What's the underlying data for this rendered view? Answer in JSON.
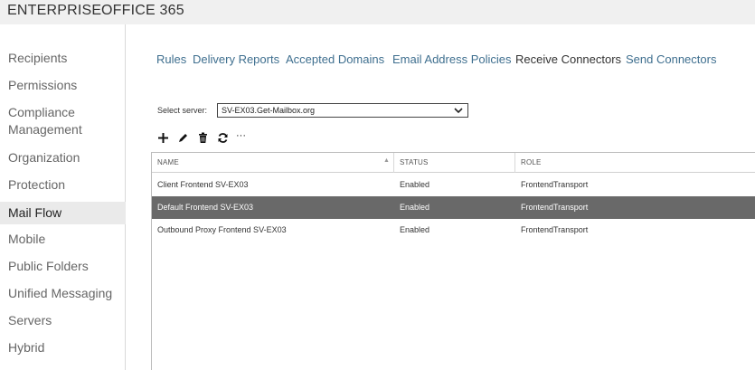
{
  "header": {
    "enterprise": "ENTERPRISE",
    "office365": "OFFICE 365"
  },
  "sidebar": {
    "items": [
      {
        "label": "Recipients"
      },
      {
        "label": "Permissions"
      },
      {
        "label": "Compliance"
      },
      {
        "label": "Management"
      },
      {
        "label": "Organization"
      },
      {
        "label": "Protection"
      },
      {
        "label": "Mail Flow"
      },
      {
        "label": "Mobile"
      },
      {
        "label": "Public Folders"
      },
      {
        "label": "Unified Messaging"
      },
      {
        "label": "Servers"
      },
      {
        "label": "Hybrid"
      }
    ],
    "active": "Mail Flow"
  },
  "tabs": [
    {
      "label": "Rules"
    },
    {
      "label": "Delivery Reports"
    },
    {
      "label": "Accepted Domains"
    },
    {
      "label": "Email Address Policies"
    },
    {
      "label": "Receive Connectors"
    },
    {
      "label": "Send Connectors"
    }
  ],
  "active_tab": "Receive Connectors",
  "server": {
    "label": "Select server:",
    "value": "SV-EX03.Get-Mailbox.org"
  },
  "toolbar": {
    "icons": [
      "add-icon",
      "edit-icon",
      "delete-icon",
      "refresh-icon",
      "more-icon"
    ],
    "more_glyph": "···"
  },
  "table": {
    "headers": {
      "name": "NAME",
      "status": "STATUS",
      "role": "ROLE"
    },
    "rows": [
      {
        "name": "Client Frontend SV-EX03",
        "status": "Enabled",
        "role": "FrontendTransport"
      },
      {
        "name": "Default Frontend SV-EX03",
        "status": "Enabled",
        "role": "FrontendTransport",
        "selected": true
      },
      {
        "name": "Outbound Proxy Frontend SV-EX03",
        "status": "Enabled",
        "role": "FrontendTransport"
      }
    ]
  },
  "colors": {
    "accent_link": "#3f6f8f",
    "selected_row": "#696969",
    "topbar": "#f0f0f0",
    "active_nav": "#eaeaea"
  }
}
